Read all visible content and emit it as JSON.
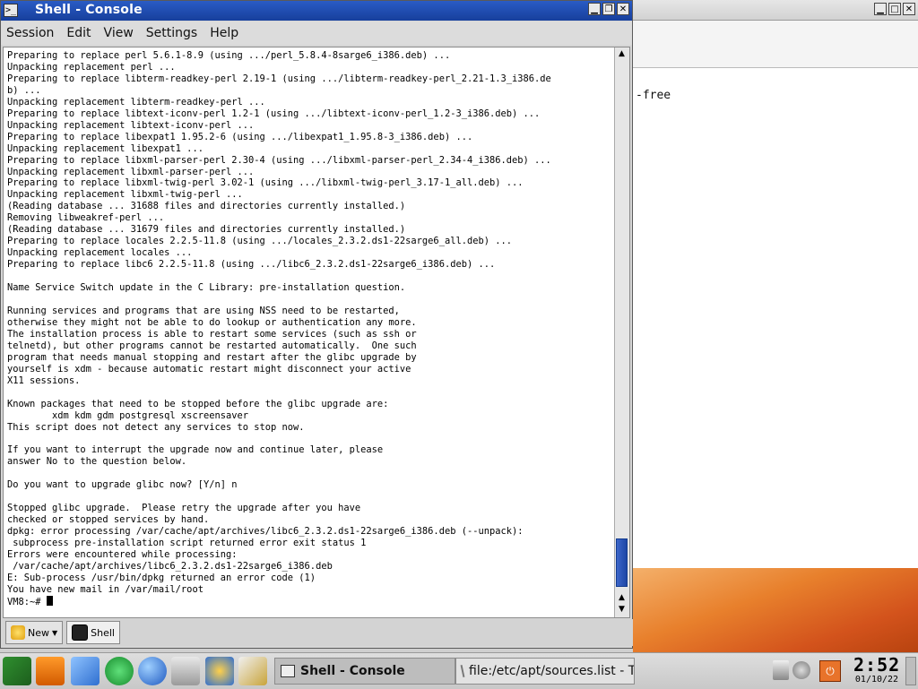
{
  "console_window": {
    "title": "Shell - Console",
    "menu": [
      "Session",
      "Edit",
      "View",
      "Settings",
      "Help"
    ],
    "terminal_lines": [
      "Preparing to replace perl 5.6.1-8.9 (using .../perl_5.8.4-8sarge6_i386.deb) ...",
      "Unpacking replacement perl ...",
      "Preparing to replace libterm-readkey-perl 2.19-1 (using .../libterm-readkey-perl_2.21-1.3_i386.de",
      "b) ...",
      "Unpacking replacement libterm-readkey-perl ...",
      "Preparing to replace libtext-iconv-perl 1.2-1 (using .../libtext-iconv-perl_1.2-3_i386.deb) ...",
      "Unpacking replacement libtext-iconv-perl ...",
      "Preparing to replace libexpat1 1.95.2-6 (using .../libexpat1_1.95.8-3_i386.deb) ...",
      "Unpacking replacement libexpat1 ...",
      "Preparing to replace libxml-parser-perl 2.30-4 (using .../libxml-parser-perl_2.34-4_i386.deb) ...",
      "Unpacking replacement libxml-parser-perl ...",
      "Preparing to replace libxml-twig-perl 3.02-1 (using .../libxml-twig-perl_3.17-1_all.deb) ...",
      "Unpacking replacement libxml-twig-perl ...",
      "(Reading database ... 31688 files and directories currently installed.)",
      "Removing libweakref-perl ...",
      "(Reading database ... 31679 files and directories currently installed.)",
      "Preparing to replace locales 2.2.5-11.8 (using .../locales_2.3.2.ds1-22sarge6_all.deb) ...",
      "Unpacking replacement locales ...",
      "Preparing to replace libc6 2.2.5-11.8 (using .../libc6_2.3.2.ds1-22sarge6_i386.deb) ...",
      "",
      "Name Service Switch update in the C Library: pre-installation question.",
      "",
      "Running services and programs that are using NSS need to be restarted,",
      "otherwise they might not be able to do lookup or authentication any more.",
      "The installation process is able to restart some services (such as ssh or",
      "telnetd), but other programs cannot be restarted automatically.  One such",
      "program that needs manual stopping and restart after the glibc upgrade by",
      "yourself is xdm - because automatic restart might disconnect your active",
      "X11 sessions.",
      "",
      "Known packages that need to be stopped before the glibc upgrade are:",
      "        xdm kdm gdm postgresql xscreensaver",
      "This script does not detect any services to stop now.",
      "",
      "If you want to interrupt the upgrade now and continue later, please",
      "answer No to the question below.",
      "",
      "Do you want to upgrade glibc now? [Y/n] n",
      "",
      "Stopped glibc upgrade.  Please retry the upgrade after you have",
      "checked or stopped services by hand.",
      "dpkg: error processing /var/cache/apt/archives/libc6_2.3.2.ds1-22sarge6_i386.deb (--unpack):",
      " subprocess pre-installation script returned error exit status 1",
      "Errors were encountered while processing:",
      " /var/cache/apt/archives/libc6_2.3.2.ds1-22sarge6_i386.deb",
      "E: Sub-process /usr/bin/dpkg returned an error code (1)",
      "You have new mail in /var/mail/root"
    ],
    "prompt": "VM8:~# ",
    "tabs": [
      {
        "label": "New",
        "icon": "new-session-icon"
      },
      {
        "label": "Shell",
        "icon": "shell-icon"
      }
    ]
  },
  "background_window": {
    "visible_text": "-free"
  },
  "taskbar": {
    "launchers": [
      "kde-menu-icon",
      "lifejacket-icon",
      "cube-icon",
      "running-man-icon",
      "globe-icon",
      "scanner-icon",
      "konqueror-icon",
      "pencil-icon"
    ],
    "tasks": [
      {
        "label": "Shell - Console",
        "active": true
      },
      {
        "label": "file:/etc/apt/sources.list - T",
        "active": false
      }
    ],
    "clock_time": "2:52",
    "clock_date": "01/10/22"
  },
  "colors": {
    "titlebar": "#1f4db5",
    "scroll_thumb": "#2d56b8",
    "wallpaper": "#e07a2c"
  }
}
